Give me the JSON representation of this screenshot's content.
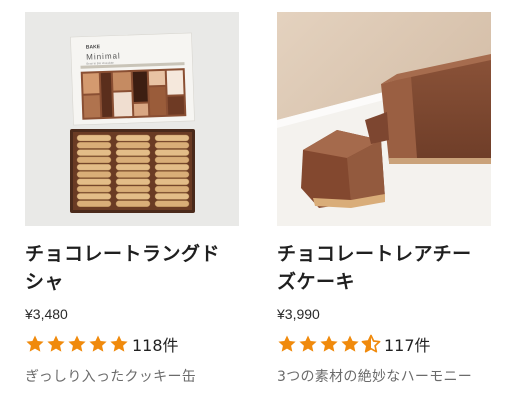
{
  "products": [
    {
      "name": "チョコレートラングドシャ",
      "name_line1": "チョコレートラングド",
      "name_line2": "シャ",
      "price": "¥3,480",
      "rating": 5.0,
      "review_count": "118件",
      "description": "ぎっしり入ったクッキー缶",
      "image_text": {
        "brand_mark": "BAKE",
        "package_label": "Minimal",
        "package_sub": "Bean to Bar chocolate"
      }
    },
    {
      "name": "チョコレートレアチーズケーキ",
      "name_line1": "チョコレートレアチー",
      "name_line2": "ズケーキ",
      "price": "¥3,990",
      "rating": 4.5,
      "review_count": "117件",
      "description": "3つの素材の絶妙なハーモニー"
    }
  ],
  "colors": {
    "star": "#f08a0c",
    "text": "#1f1f1f",
    "muted": "#6b6b6b"
  },
  "icons": {
    "star": "star-icon",
    "half_star": "half-star-icon"
  }
}
